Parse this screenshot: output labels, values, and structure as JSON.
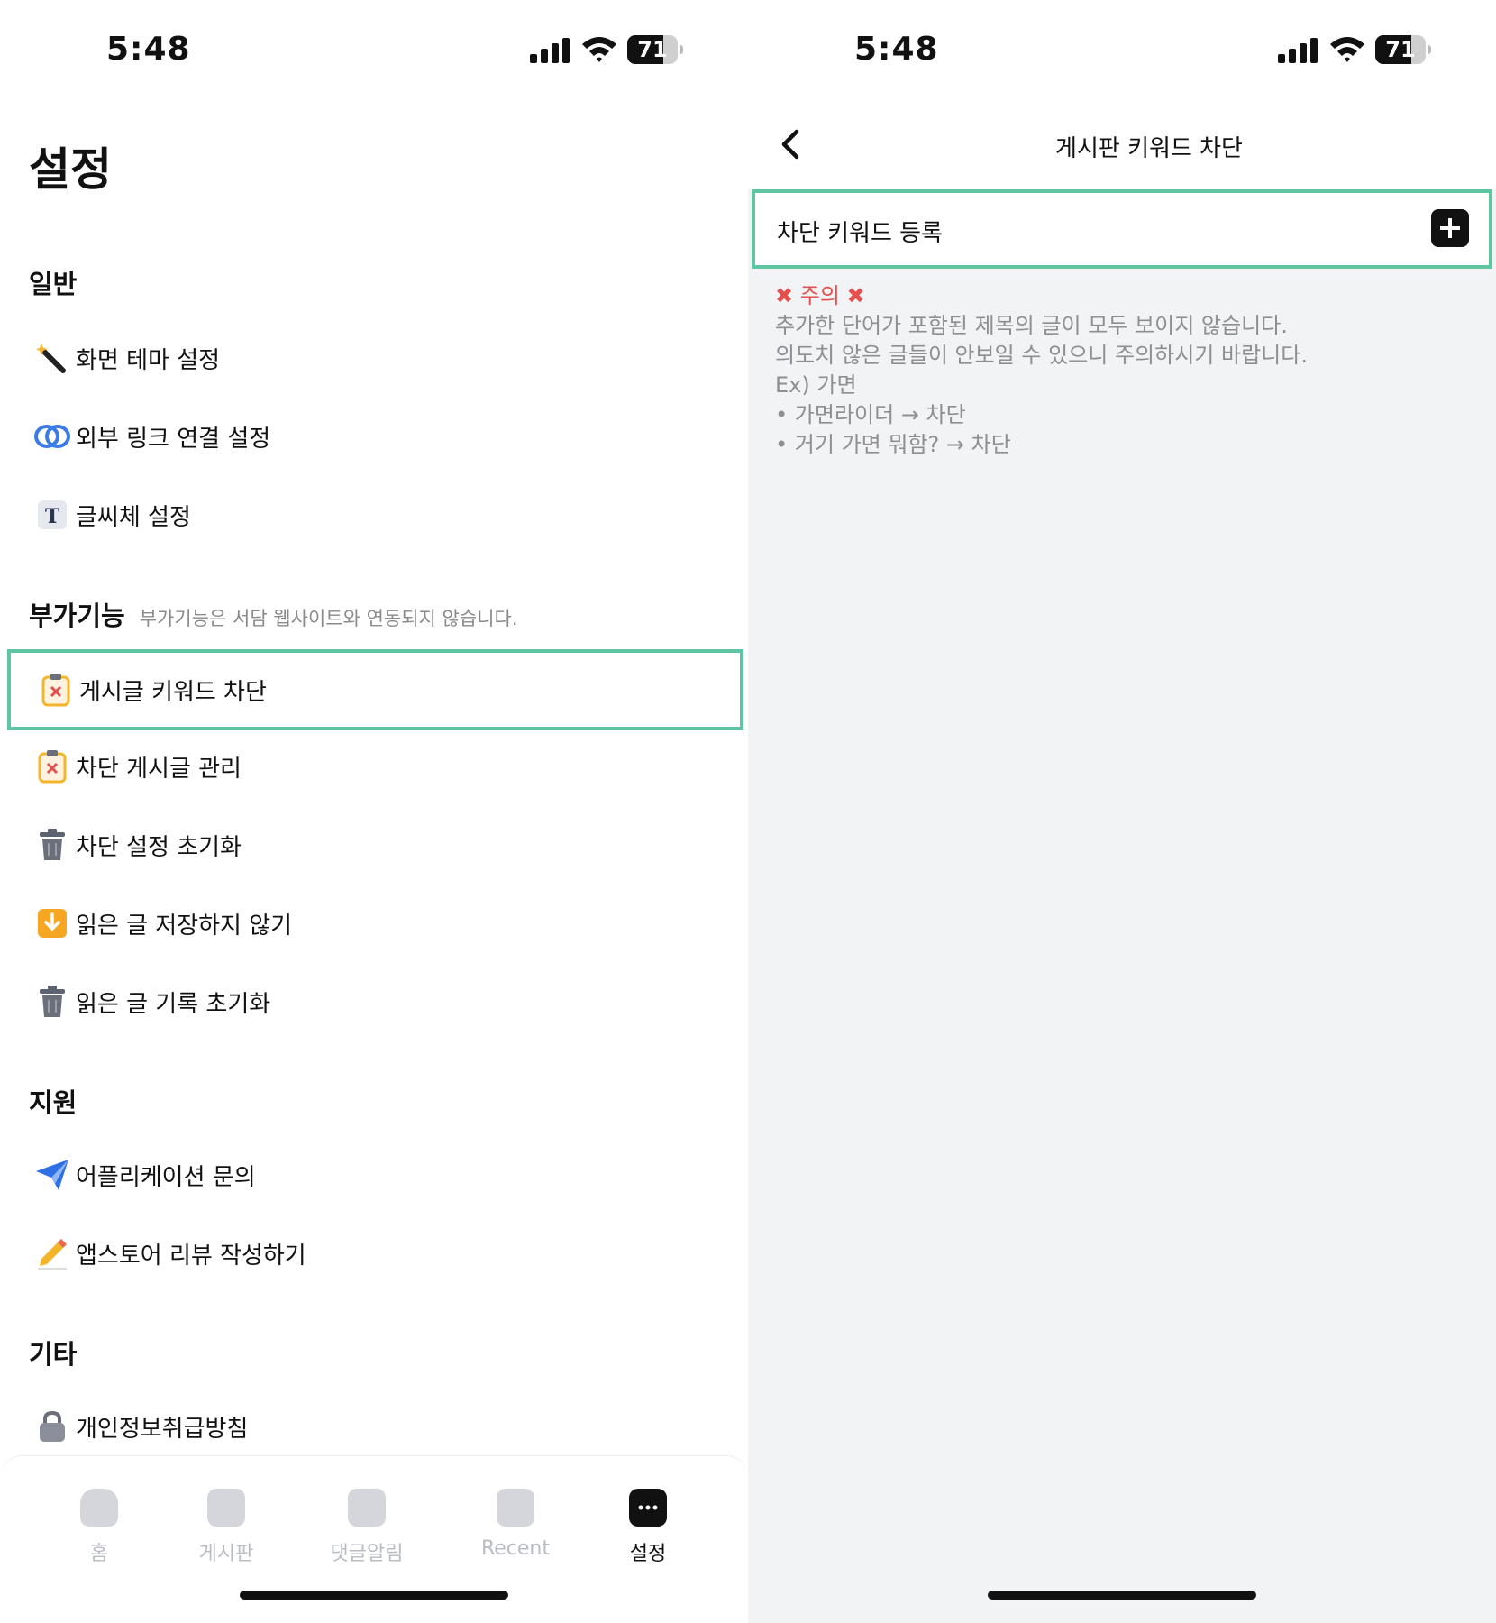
{
  "left": {
    "status": {
      "time": "5:48",
      "battery": "71",
      "battery_level": 0.71
    },
    "title": "설정",
    "sections": {
      "general": "일반",
      "extra": "부가기능",
      "extra_note": "부가기능은 서담 웹사이트와 연동되지 않습니다.",
      "support": "지원",
      "other": "기타"
    },
    "items": {
      "theme": "화면 테마 설정",
      "link": "외부 링크 연결 설정",
      "font": "글씨체 설정",
      "keyword_block": "게시글 키워드 차단",
      "blocked_posts": "차단 게시글 관리",
      "reset_block": "차단 설정 초기화",
      "no_save_read": "읽은 글 저장하지 않기",
      "reset_read": "읽은 글 기록 초기화",
      "app_inquiry": "어플리케이션 문의",
      "review": "앱스토어 리뷰 작성하기",
      "privacy": "개인정보취급방침"
    },
    "tabs": {
      "home": "홈",
      "board": "게시판",
      "comment_alert": "댓글알림",
      "recent": "Recent",
      "settings": "설정"
    }
  },
  "right": {
    "status": {
      "time": "5:48",
      "battery": "71",
      "battery_level": 0.71
    },
    "nav_title": "게시판 키워드 차단",
    "register_label": "차단 키워드 등록",
    "notice": {
      "warning": "✖ 주의 ✖",
      "line1": "추가한 단어가 포함된 제목의 글이 모두 보이지 않습니다.",
      "line2": "의도치 않은 글들이 안보일 수 있으니 주의하시기 바랍니다.",
      "line3": "Ex) 가면",
      "line4": "• 가면라이더 → 차단",
      "line5": "• 거기 가면 뭐함? → 차단"
    }
  },
  "colors": {
    "highlight": "#5fc4a0",
    "warning": "#e34f4f",
    "background_right": "#f2f3f5"
  }
}
